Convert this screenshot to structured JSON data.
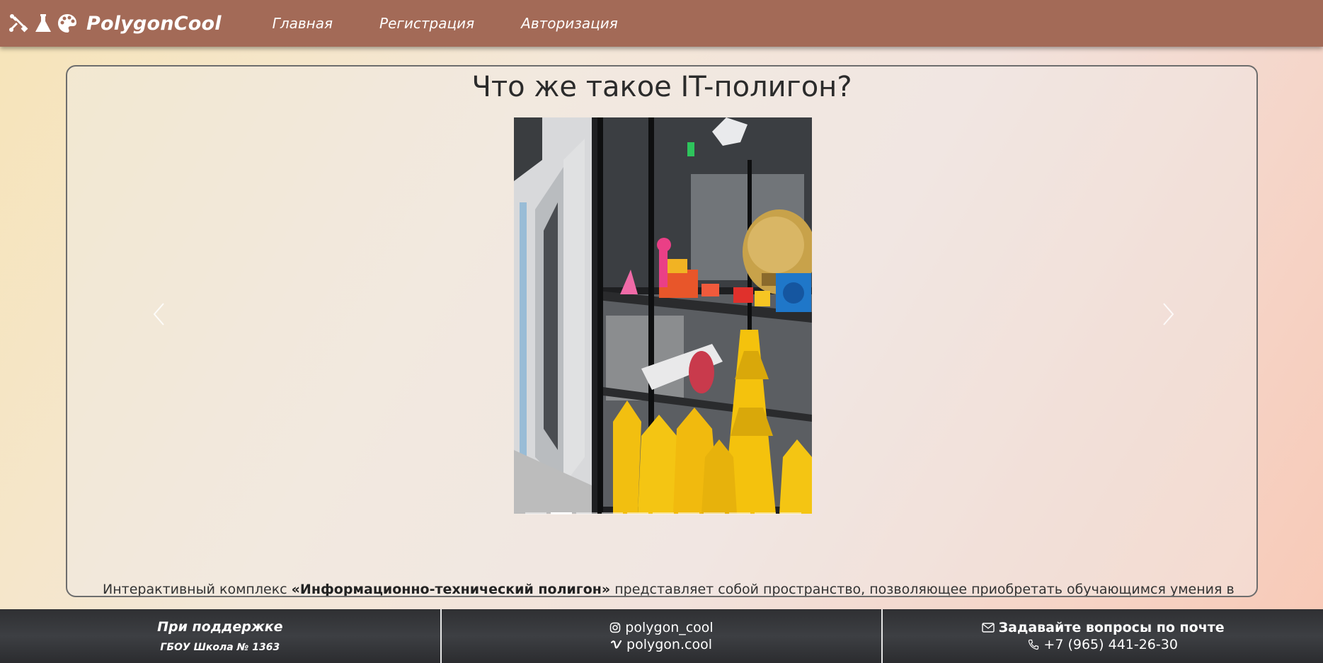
{
  "navbar": {
    "brand": "PolygonCool",
    "brand_icons": [
      "tools-icon",
      "flask-icon",
      "palette-icon"
    ],
    "links": [
      "Главная",
      "Регистрация",
      "Авторизация"
    ],
    "background": "#a36a57"
  },
  "main": {
    "title": "Что же такое IT-полигон?",
    "carousel": {
      "slide_count": 11,
      "active_index": 1,
      "image_description": "photo-shelf-3d-printed-models",
      "prev_icon": "chevron-left-icon",
      "next_icon": "chevron-right-icon"
    },
    "text_prefix": "Интерактивный комплекс ",
    "text_bold": "«Информационно-технический полигон»",
    "text_suffix": " представляет собой пространство, позволяющее приобретать обучающимся умения в"
  },
  "footer": {
    "support_title": "При поддержке",
    "support_sub": "ГБОУ Школа № 1363",
    "instagram": "polygon_cool",
    "vimeo": "polygon.cool",
    "mail_text": "Задавайте вопросы по почте",
    "phone": "+7 (965) 441-26-30",
    "background": "#36383b"
  }
}
